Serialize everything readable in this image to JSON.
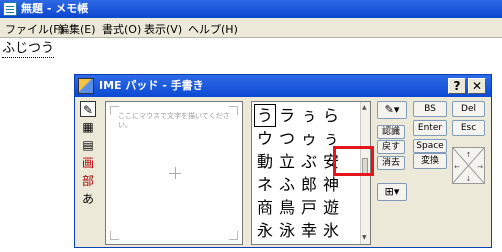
{
  "notepad": {
    "title": "無題 - メモ帳",
    "menu": [
      "ファイル(F)",
      "編集(E)",
      "書式(O)",
      "表示(V)",
      "ヘルプ(H)"
    ],
    "document_text": "ふじつう"
  },
  "ime_pad": {
    "title": "IME パッド - 手書き",
    "help_label": "?",
    "close_label": "✕",
    "tools": [
      "pen-icon",
      "grid-icon",
      "keyboard-icon",
      "square-icon",
      "radical-icon",
      "circle-icon"
    ],
    "tool_labels": [
      "✎",
      "▦",
      "▤",
      "画",
      "部",
      "あ"
    ],
    "draw_hint": "ここにマウスで文字を描いてください。",
    "candidates": [
      [
        "う",
        "ラ",
        "ぅ",
        "ら"
      ],
      [
        "ウ",
        "つ",
        "ゥ",
        "ぅ"
      ],
      [
        "動",
        "立",
        "ぶ",
        "安"
      ],
      [
        "ネ",
        "ふ",
        "郎",
        "神"
      ],
      [
        "商",
        "鳥",
        "戸",
        "遊"
      ],
      [
        "永",
        "泳",
        "幸",
        "氷"
      ]
    ],
    "mid_buttons": {
      "recognize": "認識",
      "back": "戻す",
      "clear": "消去"
    },
    "right_buttons": {
      "bs": "BS",
      "del": "Del",
      "enter": "Enter",
      "esc": "Esc",
      "space": "Space",
      "convert": "変換"
    }
  }
}
